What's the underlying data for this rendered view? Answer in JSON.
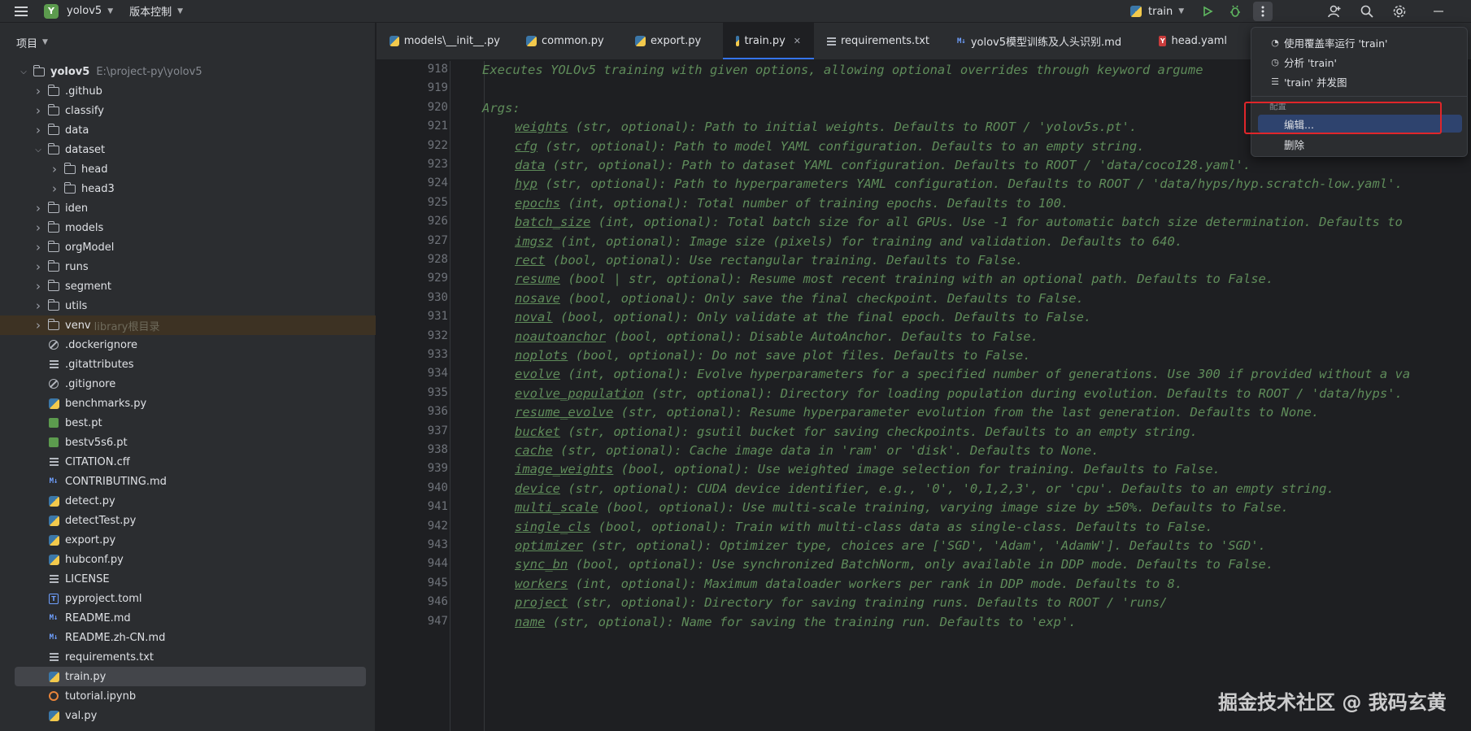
{
  "titlebar": {
    "project_badge": "Y",
    "project_name": "yolov5",
    "vcs_label": "版本控制",
    "run_config": "train"
  },
  "project_panel": {
    "title": "项目",
    "root": {
      "name": "yolov5",
      "path": "E:\\project-py\\yolov5"
    },
    "items": [
      {
        "name": ".github",
        "type": "folder",
        "depth": 1,
        "expand": "closed"
      },
      {
        "name": "classify",
        "type": "folder",
        "depth": 1,
        "expand": "closed"
      },
      {
        "name": "data",
        "type": "folder",
        "depth": 1,
        "expand": "closed"
      },
      {
        "name": "dataset",
        "type": "folder",
        "depth": 1,
        "expand": "open"
      },
      {
        "name": "head",
        "type": "folder",
        "depth": 2,
        "expand": "closed"
      },
      {
        "name": "head3",
        "type": "folder",
        "depth": 2,
        "expand": "closed"
      },
      {
        "name": "iden",
        "type": "folder",
        "depth": 1,
        "expand": "closed"
      },
      {
        "name": "models",
        "type": "folder",
        "depth": 1,
        "expand": "closed"
      },
      {
        "name": "orgModel",
        "type": "folder",
        "depth": 1,
        "expand": "closed"
      },
      {
        "name": "runs",
        "type": "folder",
        "depth": 1,
        "expand": "closed"
      },
      {
        "name": "segment",
        "type": "folder",
        "depth": 1,
        "expand": "closed"
      },
      {
        "name": "utils",
        "type": "folder",
        "depth": 1,
        "expand": "closed"
      },
      {
        "name": "venv",
        "type": "folder",
        "depth": 1,
        "expand": "closed",
        "note": "library根目录"
      },
      {
        "name": ".dockerignore",
        "type": "ignore",
        "depth": 1
      },
      {
        "name": ".gitattributes",
        "type": "text",
        "depth": 1
      },
      {
        "name": ".gitignore",
        "type": "ignore",
        "depth": 1
      },
      {
        "name": "benchmarks.py",
        "type": "python",
        "depth": 1
      },
      {
        "name": "best.pt",
        "type": "pt",
        "depth": 1
      },
      {
        "name": "bestv5s6.pt",
        "type": "pt",
        "depth": 1
      },
      {
        "name": "CITATION.cff",
        "type": "text",
        "depth": 1
      },
      {
        "name": "CONTRIBUTING.md",
        "type": "markdown",
        "depth": 1
      },
      {
        "name": "detect.py",
        "type": "python",
        "depth": 1
      },
      {
        "name": "detectTest.py",
        "type": "python",
        "depth": 1
      },
      {
        "name": "export.py",
        "type": "python",
        "depth": 1
      },
      {
        "name": "hubconf.py",
        "type": "python",
        "depth": 1
      },
      {
        "name": "LICENSE",
        "type": "text",
        "depth": 1
      },
      {
        "name": "pyproject.toml",
        "type": "toml",
        "depth": 1
      },
      {
        "name": "README.md",
        "type": "markdown",
        "depth": 1
      },
      {
        "name": "README.zh-CN.md",
        "type": "markdown",
        "depth": 1
      },
      {
        "name": "requirements.txt",
        "type": "text",
        "depth": 1
      },
      {
        "name": "train.py",
        "type": "python",
        "depth": 1,
        "selected": true
      },
      {
        "name": "tutorial.ipynb",
        "type": "notebook",
        "depth": 1
      },
      {
        "name": "val.py",
        "type": "python",
        "depth": 1
      }
    ]
  },
  "tabs": [
    {
      "label": "models\\__init__.py",
      "icon": "python-icon"
    },
    {
      "label": "common.py",
      "icon": "python-icon"
    },
    {
      "label": "export.py",
      "icon": "python-icon"
    },
    {
      "label": "train.py",
      "icon": "python-icon",
      "active": true
    },
    {
      "label": "requirements.txt",
      "icon": "text-icon"
    },
    {
      "label": "yolov5模型训练及人头识别.md",
      "icon": "markdown-icon"
    },
    {
      "label": "head.yaml",
      "icon": "yaml-icon"
    }
  ],
  "editor": {
    "lines": [
      {
        "no": "918",
        "indent": 1,
        "text": "Executes YOLOv5 training with given options, allowing optional overrides through keyword argume"
      },
      {
        "no": "919",
        "indent": 0,
        "text": ""
      },
      {
        "no": "920",
        "indent": 1,
        "text": "Args:"
      },
      {
        "no": "921",
        "indent": 2,
        "param": "weights",
        "text": " (str, optional): Path to initial weights. Defaults to ROOT / 'yolov5s.pt'."
      },
      {
        "no": "922",
        "indent": 2,
        "param": "cfg",
        "text": " (str, optional): Path to model YAML configuration. Defaults to an empty string."
      },
      {
        "no": "923",
        "indent": 2,
        "param": "data",
        "text": " (str, optional): Path to dataset YAML configuration. Defaults to ROOT / 'data/coco128.yaml'."
      },
      {
        "no": "924",
        "indent": 2,
        "param": "hyp",
        "text": " (str, optional): Path to hyperparameters YAML configuration. Defaults to ROOT / 'data/hyps/hyp.scratch-low.yaml'."
      },
      {
        "no": "925",
        "indent": 2,
        "param": "epochs",
        "text": " (int, optional): Total number of training epochs. Defaults to 100."
      },
      {
        "no": "926",
        "indent": 2,
        "param": "batch_size",
        "text": " (int, optional): Total batch size for all GPUs. Use -1 for automatic batch size determination. Defaults to"
      },
      {
        "no": "927",
        "indent": 2,
        "param": "imgsz",
        "text": " (int, optional): Image size (pixels) for training and validation. Defaults to 640."
      },
      {
        "no": "928",
        "indent": 2,
        "param": "rect",
        "text": " (bool, optional): Use rectangular training. Defaults to False."
      },
      {
        "no": "929",
        "indent": 2,
        "param": "resume",
        "text": " (bool | str, optional): Resume most recent training with an optional path. Defaults to False."
      },
      {
        "no": "930",
        "indent": 2,
        "param": "nosave",
        "text": " (bool, optional): Only save the final checkpoint. Defaults to False."
      },
      {
        "no": "931",
        "indent": 2,
        "param": "noval",
        "text": " (bool, optional): Only validate at the final epoch. Defaults to False."
      },
      {
        "no": "932",
        "indent": 2,
        "param": "noautoanchor",
        "text": " (bool, optional): Disable AutoAnchor. Defaults to False."
      },
      {
        "no": "933",
        "indent": 2,
        "param": "noplots",
        "text": " (bool, optional): Do not save plot files. Defaults to False."
      },
      {
        "no": "934",
        "indent": 2,
        "param": "evolve",
        "text": " (int, optional): Evolve hyperparameters for a specified number of generations. Use 300 if provided without a va"
      },
      {
        "no": "935",
        "indent": 2,
        "param": "evolve_population",
        "text": " (str, optional): Directory for loading population during evolution. Defaults to ROOT / 'data/hyps'."
      },
      {
        "no": "936",
        "indent": 2,
        "param": "resume_evolve",
        "text": " (str, optional): Resume hyperparameter evolution from the last generation. Defaults to None."
      },
      {
        "no": "937",
        "indent": 2,
        "param": "bucket",
        "text": " (str, optional): gsutil bucket for saving checkpoints. Defaults to an empty string."
      },
      {
        "no": "938",
        "indent": 2,
        "param": "cache",
        "text": " (str, optional): Cache image data in 'ram' or 'disk'. Defaults to None."
      },
      {
        "no": "939",
        "indent": 2,
        "param": "image_weights",
        "text": " (bool, optional): Use weighted image selection for training. Defaults to False."
      },
      {
        "no": "940",
        "indent": 2,
        "param": "device",
        "text": " (str, optional): CUDA device identifier, e.g., '0', '0,1,2,3', or 'cpu'. Defaults to an empty string."
      },
      {
        "no": "941",
        "indent": 2,
        "param": "multi_scale",
        "text": " (bool, optional): Use multi-scale training, varying image size by ±50%. Defaults to False."
      },
      {
        "no": "942",
        "indent": 2,
        "param": "single_cls",
        "text": " (bool, optional): Train with multi-class data as single-class. Defaults to False."
      },
      {
        "no": "943",
        "indent": 2,
        "param": "optimizer",
        "text": " (str, optional): Optimizer type, choices are ['SGD', 'Adam', 'AdamW']. Defaults to 'SGD'."
      },
      {
        "no": "944",
        "indent": 2,
        "param": "sync_bn",
        "text": " (bool, optional): Use synchronized BatchNorm, only available in DDP mode. Defaults to False."
      },
      {
        "no": "945",
        "indent": 2,
        "param": "workers",
        "text": " (int, optional): Maximum dataloader workers per rank in DDP mode. Defaults to 8."
      },
      {
        "no": "946",
        "indent": 2,
        "param": "project",
        "text": " (str, optional): Directory for saving training runs. Defaults to ROOT / 'runs/"
      },
      {
        "no": "947",
        "indent": 2,
        "param": "name",
        "text": " (str, optional): Name for saving the training run. Defaults to 'exp'."
      }
    ]
  },
  "popup_menu": {
    "run_with_coverage": "使用覆盖率运行 'train'",
    "profile": "分析 'train'",
    "concurrency_diagram": "'train' 并发图",
    "section_label": "配置",
    "edit": "编辑...",
    "delete": "删除"
  },
  "watermark": "掘金技术社区 @ 我码玄黄"
}
